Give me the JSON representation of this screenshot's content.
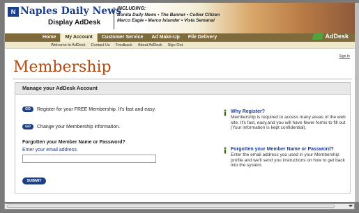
{
  "header": {
    "logo_mark": "N",
    "logo_name": "Naples Daily News",
    "logo_sub": "Display AdDesk",
    "including_label": "INCLUDING:",
    "including_line1": "Bonita Daily News • The Banner • Collier Citizen",
    "including_line2": "Marco Eagle • Marco Islander • Vista Semanal"
  },
  "nav": {
    "tabs": [
      "Home",
      "My Account",
      "Customer Service",
      "Ad Make-Up",
      "File Delivery"
    ],
    "active_tab": "My Account",
    "brand": "AdDesk"
  },
  "subnav": {
    "items": [
      "Welcome to AdDesk",
      "Contact Us",
      "Feedback",
      "About AdDesk",
      "Sign Out"
    ]
  },
  "signin": "Sign In",
  "page_title": "Membership",
  "panel": {
    "heading": "Manage your AdDesk Account",
    "go_label": "GO",
    "register_text": "Register for your FREE Membership. It's fast and easy.",
    "change_text": "Change your Membership information.",
    "forgot_title": "Forgotten your Member Name or Password?",
    "email_label": "Enter your email address.",
    "email_value": "",
    "submit_label": "SUBMIT"
  },
  "help": [
    {
      "title": "Why Register?",
      "body": "Membership is required to access many areas of the web site. It's fast, easy,and you will have fewer forms to fill out (Your information is kept confidential)."
    },
    {
      "title": "Forgotten your Member Name or Password?",
      "body": "Enter the email address you used in your Membership profile and we'll send you instructions on how to get back into the system."
    }
  ],
  "colors": {
    "brand_blue": "#1b3f8f",
    "title_orange": "#b04a12",
    "nav_brown": "#7e6a3a",
    "adesk_green": "#4fa43d"
  }
}
